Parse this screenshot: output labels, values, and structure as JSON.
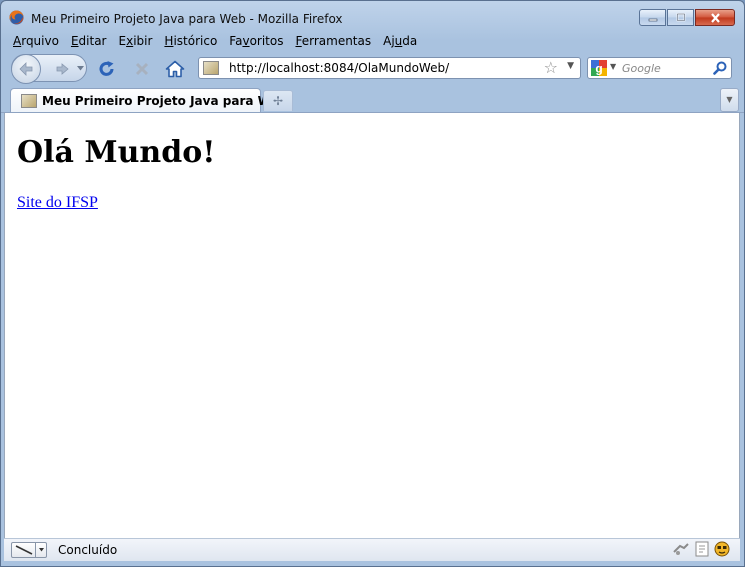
{
  "window": {
    "title": "Meu Primeiro Projeto Java para Web - Mozilla Firefox",
    "controls": [
      "minimize-icon",
      "maximize-icon",
      "close-icon"
    ]
  },
  "menu": {
    "items": [
      {
        "label": "Arquivo",
        "access_key": "A"
      },
      {
        "label": "Editar",
        "access_key": "E"
      },
      {
        "label": "Exibir",
        "access_key": "x"
      },
      {
        "label": "Histórico",
        "access_key": "H"
      },
      {
        "label": "Favoritos",
        "access_key": "v"
      },
      {
        "label": "Ferramentas",
        "access_key": "F"
      },
      {
        "label": "Ajuda",
        "access_key": "u"
      }
    ]
  },
  "toolbar": {
    "icons": [
      "back-icon",
      "forward-icon",
      "reload-icon",
      "stop-icon",
      "home-icon"
    ]
  },
  "address_bar": {
    "url": "http://localhost:8084/OlaMundoWeb/"
  },
  "search": {
    "placeholder": "Google",
    "engine_icon": "google-icon"
  },
  "tabs": [
    {
      "title": "Meu Primeiro Projeto Java para Web",
      "active": true
    }
  ],
  "page": {
    "heading": "Olá Mundo!",
    "link_text": "Site do IFSP"
  },
  "status": {
    "text": "Concluído"
  },
  "colors": {
    "chrome": "#bfd3ea",
    "link": "#0000ee",
    "close_button": "#c8432a"
  }
}
